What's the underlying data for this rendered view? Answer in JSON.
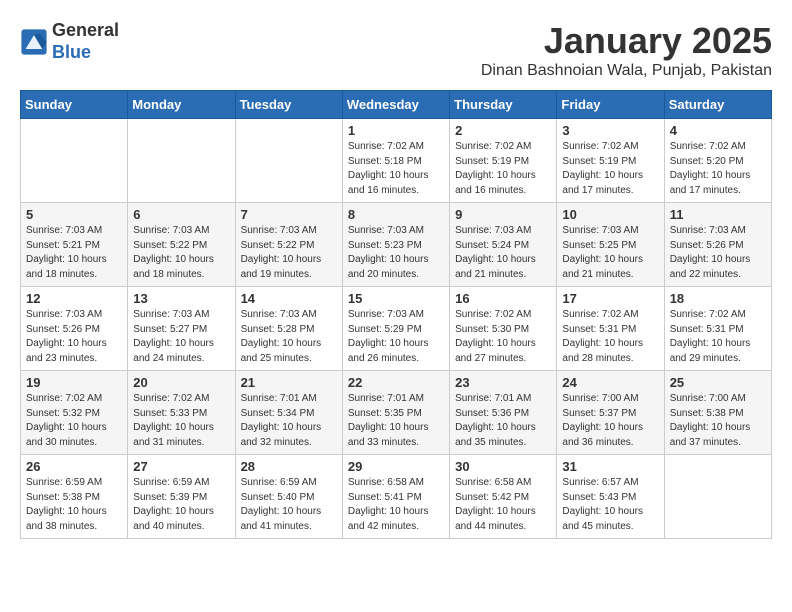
{
  "header": {
    "logo_line1": "General",
    "logo_line2": "Blue",
    "month_title": "January 2025",
    "subtitle": "Dinan Bashnoian Wala, Punjab, Pakistan"
  },
  "weekdays": [
    "Sunday",
    "Monday",
    "Tuesday",
    "Wednesday",
    "Thursday",
    "Friday",
    "Saturday"
  ],
  "weeks": [
    [
      {
        "day": "",
        "info": ""
      },
      {
        "day": "",
        "info": ""
      },
      {
        "day": "",
        "info": ""
      },
      {
        "day": "1",
        "info": "Sunrise: 7:02 AM\nSunset: 5:18 PM\nDaylight: 10 hours\nand 16 minutes."
      },
      {
        "day": "2",
        "info": "Sunrise: 7:02 AM\nSunset: 5:19 PM\nDaylight: 10 hours\nand 16 minutes."
      },
      {
        "day": "3",
        "info": "Sunrise: 7:02 AM\nSunset: 5:19 PM\nDaylight: 10 hours\nand 17 minutes."
      },
      {
        "day": "4",
        "info": "Sunrise: 7:02 AM\nSunset: 5:20 PM\nDaylight: 10 hours\nand 17 minutes."
      }
    ],
    [
      {
        "day": "5",
        "info": "Sunrise: 7:03 AM\nSunset: 5:21 PM\nDaylight: 10 hours\nand 18 minutes."
      },
      {
        "day": "6",
        "info": "Sunrise: 7:03 AM\nSunset: 5:22 PM\nDaylight: 10 hours\nand 18 minutes."
      },
      {
        "day": "7",
        "info": "Sunrise: 7:03 AM\nSunset: 5:22 PM\nDaylight: 10 hours\nand 19 minutes."
      },
      {
        "day": "8",
        "info": "Sunrise: 7:03 AM\nSunset: 5:23 PM\nDaylight: 10 hours\nand 20 minutes."
      },
      {
        "day": "9",
        "info": "Sunrise: 7:03 AM\nSunset: 5:24 PM\nDaylight: 10 hours\nand 21 minutes."
      },
      {
        "day": "10",
        "info": "Sunrise: 7:03 AM\nSunset: 5:25 PM\nDaylight: 10 hours\nand 21 minutes."
      },
      {
        "day": "11",
        "info": "Sunrise: 7:03 AM\nSunset: 5:26 PM\nDaylight: 10 hours\nand 22 minutes."
      }
    ],
    [
      {
        "day": "12",
        "info": "Sunrise: 7:03 AM\nSunset: 5:26 PM\nDaylight: 10 hours\nand 23 minutes."
      },
      {
        "day": "13",
        "info": "Sunrise: 7:03 AM\nSunset: 5:27 PM\nDaylight: 10 hours\nand 24 minutes."
      },
      {
        "day": "14",
        "info": "Sunrise: 7:03 AM\nSunset: 5:28 PM\nDaylight: 10 hours\nand 25 minutes."
      },
      {
        "day": "15",
        "info": "Sunrise: 7:03 AM\nSunset: 5:29 PM\nDaylight: 10 hours\nand 26 minutes."
      },
      {
        "day": "16",
        "info": "Sunrise: 7:02 AM\nSunset: 5:30 PM\nDaylight: 10 hours\nand 27 minutes."
      },
      {
        "day": "17",
        "info": "Sunrise: 7:02 AM\nSunset: 5:31 PM\nDaylight: 10 hours\nand 28 minutes."
      },
      {
        "day": "18",
        "info": "Sunrise: 7:02 AM\nSunset: 5:31 PM\nDaylight: 10 hours\nand 29 minutes."
      }
    ],
    [
      {
        "day": "19",
        "info": "Sunrise: 7:02 AM\nSunset: 5:32 PM\nDaylight: 10 hours\nand 30 minutes."
      },
      {
        "day": "20",
        "info": "Sunrise: 7:02 AM\nSunset: 5:33 PM\nDaylight: 10 hours\nand 31 minutes."
      },
      {
        "day": "21",
        "info": "Sunrise: 7:01 AM\nSunset: 5:34 PM\nDaylight: 10 hours\nand 32 minutes."
      },
      {
        "day": "22",
        "info": "Sunrise: 7:01 AM\nSunset: 5:35 PM\nDaylight: 10 hours\nand 33 minutes."
      },
      {
        "day": "23",
        "info": "Sunrise: 7:01 AM\nSunset: 5:36 PM\nDaylight: 10 hours\nand 35 minutes."
      },
      {
        "day": "24",
        "info": "Sunrise: 7:00 AM\nSunset: 5:37 PM\nDaylight: 10 hours\nand 36 minutes."
      },
      {
        "day": "25",
        "info": "Sunrise: 7:00 AM\nSunset: 5:38 PM\nDaylight: 10 hours\nand 37 minutes."
      }
    ],
    [
      {
        "day": "26",
        "info": "Sunrise: 6:59 AM\nSunset: 5:38 PM\nDaylight: 10 hours\nand 38 minutes."
      },
      {
        "day": "27",
        "info": "Sunrise: 6:59 AM\nSunset: 5:39 PM\nDaylight: 10 hours\nand 40 minutes."
      },
      {
        "day": "28",
        "info": "Sunrise: 6:59 AM\nSunset: 5:40 PM\nDaylight: 10 hours\nand 41 minutes."
      },
      {
        "day": "29",
        "info": "Sunrise: 6:58 AM\nSunset: 5:41 PM\nDaylight: 10 hours\nand 42 minutes."
      },
      {
        "day": "30",
        "info": "Sunrise: 6:58 AM\nSunset: 5:42 PM\nDaylight: 10 hours\nand 44 minutes."
      },
      {
        "day": "31",
        "info": "Sunrise: 6:57 AM\nSunset: 5:43 PM\nDaylight: 10 hours\nand 45 minutes."
      },
      {
        "day": "",
        "info": ""
      }
    ]
  ]
}
